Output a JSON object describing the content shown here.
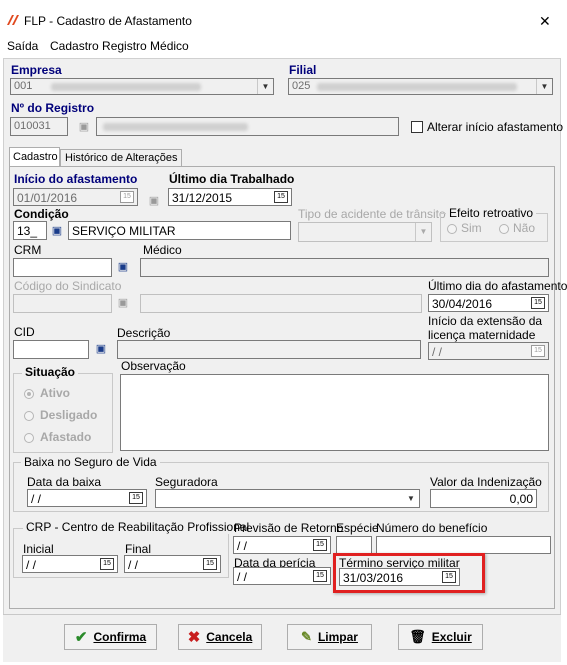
{
  "window": {
    "title": "FLP - Cadastro de Afastamento",
    "close_glyph": "✕"
  },
  "menu": [
    "Saída",
    "Cadastro Registro Médico"
  ],
  "empresa": {
    "label": "Empresa",
    "code": "001"
  },
  "filial": {
    "label": "Filial",
    "code": "025"
  },
  "registro": {
    "label": "Nº do Registro",
    "value": "010031"
  },
  "alterar_inicio": {
    "label": "Alterar início afastamento"
  },
  "tabs": [
    "Cadastro",
    "Histórico de Alterações"
  ],
  "inicio": {
    "label": "Início do afastamento",
    "value": "01/01/2016"
  },
  "ultimo_trab": {
    "label": "Último dia Trabalhado",
    "value": "31/12/2015"
  },
  "condicao": {
    "label": "Condição",
    "code": "13_",
    "desc": "SERVIÇO MILITAR"
  },
  "tipo_acidente": {
    "label": "Tipo de acidente de trânsito"
  },
  "efeito": {
    "label": "Efeito retroativo",
    "sim": "Sim",
    "nao": "Não"
  },
  "crm": {
    "label": "CRM"
  },
  "medico": {
    "label": "Médico"
  },
  "sindicato": {
    "label": "Código do Sindicato"
  },
  "ultimo_afast": {
    "label": "Último dia do afastamento",
    "value": "30/04/2016"
  },
  "inicio_ext": {
    "label1": "Início da extensão da",
    "label2": "licença maternidade",
    "value": "/ /"
  },
  "cid": {
    "label": "CID"
  },
  "descricao": {
    "label": "Descrição"
  },
  "situacao": {
    "label": "Situação",
    "ativo": "Ativo",
    "desligado": "Desligado",
    "afastado": "Afastado"
  },
  "observacao": {
    "label": "Observação"
  },
  "baixa": {
    "label": "Baixa no Seguro de Vida",
    "data_label": "Data da baixa",
    "data_value": "/ /",
    "seguradora_label": "Seguradora",
    "valor_label": "Valor da Indenização",
    "valor_value": "0,00"
  },
  "crp": {
    "label": "CRP - Centro de Reabilitação Profissional",
    "inicial_label": "Inicial",
    "inicial_value": "/ /",
    "final_label": "Final",
    "final_value": "/ /"
  },
  "previsao": {
    "label": "Previsão de Retorno",
    "value": "/ /"
  },
  "especie": {
    "label": "Espécie"
  },
  "numero_beneficio": {
    "label": "Número do benefício"
  },
  "data_pericia": {
    "label": "Data da perícia",
    "value": "/ /"
  },
  "termino_militar": {
    "label": "Término serviço militar",
    "value": "31/03/2016"
  },
  "buttons": {
    "confirma": "Confirma",
    "cancela": "Cancela",
    "limpar": "Limpar",
    "excluir": "Excluir"
  },
  "colors": {
    "label_blue": "#00007a",
    "highlight_red": "#e02020",
    "confirm_green": "#2a8a2a",
    "cancel_red": "#c81e1e",
    "app_icon": "#e0481e"
  }
}
